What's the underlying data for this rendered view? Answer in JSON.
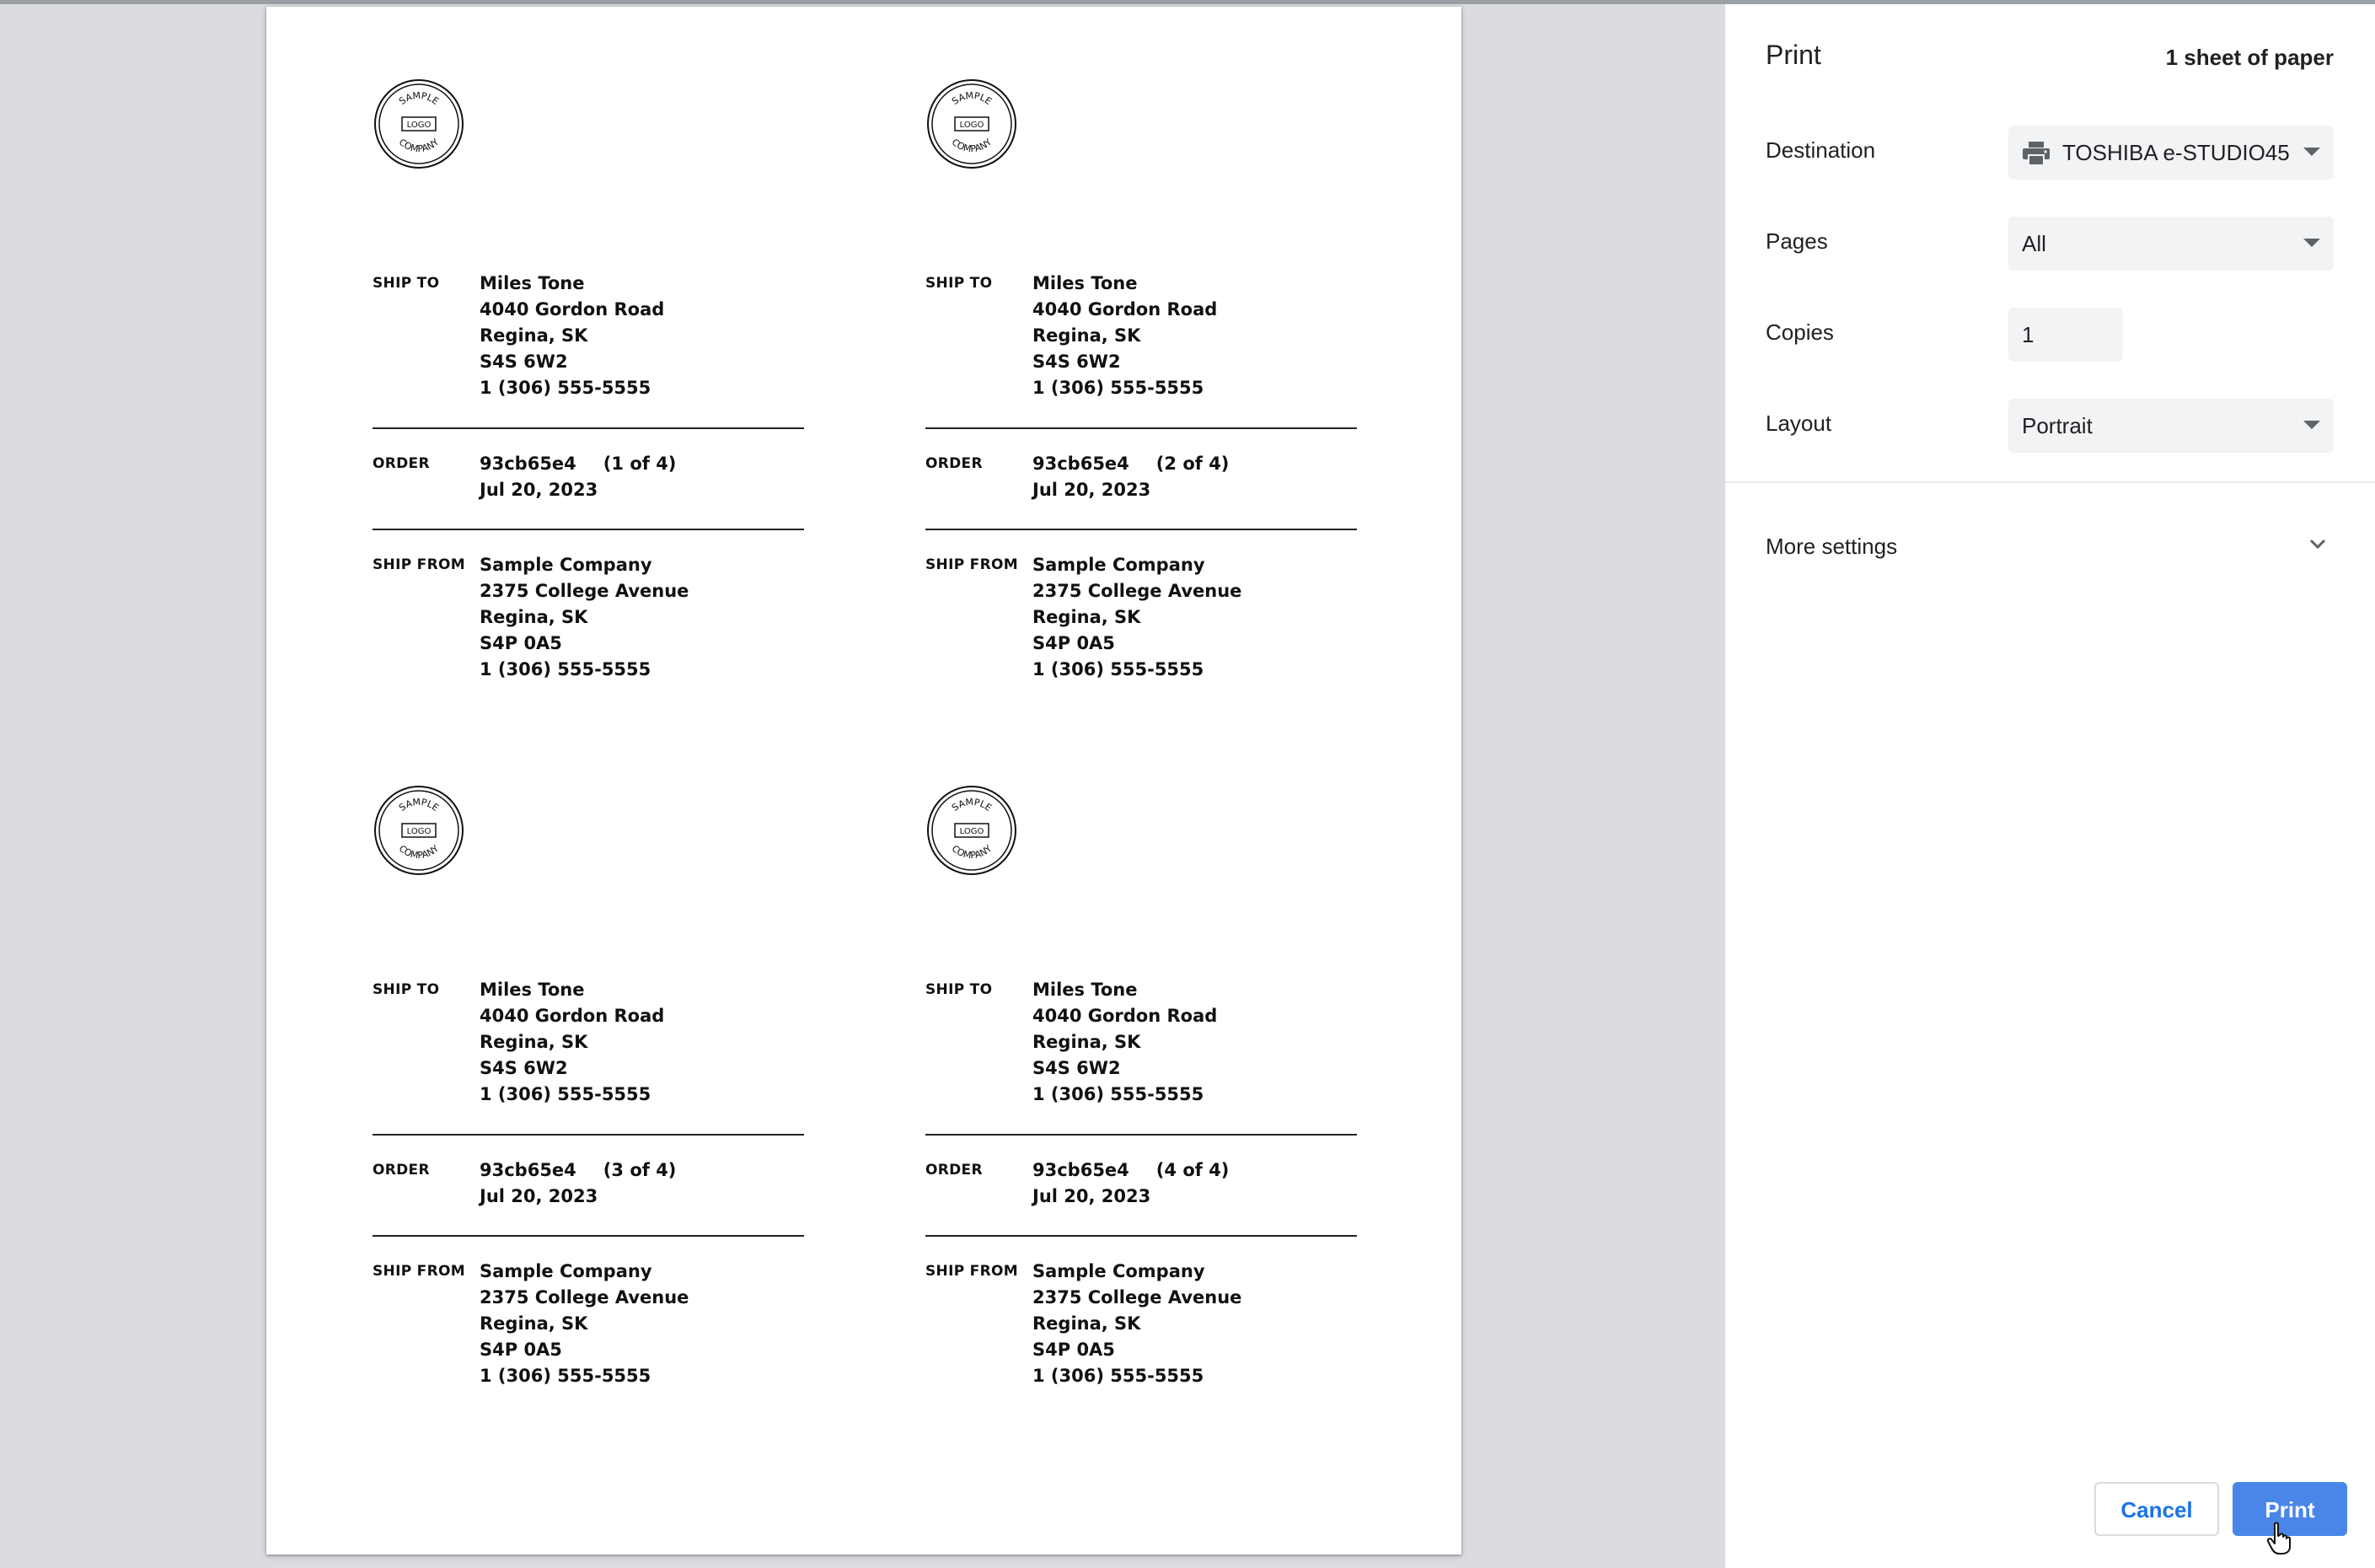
{
  "sidebar": {
    "title": "Print",
    "sheet_count": "1 sheet of paper",
    "destination": {
      "label": "Destination",
      "value": "TOSHIBA e-STUDIO45",
      "icon": "printer-icon"
    },
    "pages": {
      "label": "Pages",
      "value": "All"
    },
    "copies": {
      "label": "Copies",
      "value": "1"
    },
    "layout": {
      "label": "Layout",
      "value": "Portrait"
    },
    "more_settings": {
      "label": "More settings",
      "icon": "chevron-down-icon"
    },
    "cancel_label": "Cancel",
    "print_label": "Print",
    "accent_color": "#4a86e8"
  },
  "labels": [
    {
      "logo_text": {
        "top": "SAMPLE",
        "middle": "LOGO",
        "bottom": "COMPANY"
      },
      "ship_to": {
        "heading": "SHIP TO",
        "lines": [
          "Miles Tone",
          "4040 Gordon Road",
          "Regina, SK",
          "S4S 6W2",
          "1 (306) 555-5555"
        ]
      },
      "order": {
        "heading": "ORDER",
        "id": "93cb65e4",
        "index": "(1 of 4)",
        "date": "Jul 20, 2023"
      },
      "ship_from": {
        "heading": "SHIP FROM",
        "lines": [
          "Sample Company",
          "2375 College Avenue",
          "Regina, SK",
          "S4P 0A5",
          "1 (306) 555-5555"
        ]
      }
    },
    {
      "logo_text": {
        "top": "SAMPLE",
        "middle": "LOGO",
        "bottom": "COMPANY"
      },
      "ship_to": {
        "heading": "SHIP TO",
        "lines": [
          "Miles Tone",
          "4040 Gordon Road",
          "Regina, SK",
          "S4S 6W2",
          "1 (306) 555-5555"
        ]
      },
      "order": {
        "heading": "ORDER",
        "id": "93cb65e4",
        "index": "(2 of 4)",
        "date": "Jul 20, 2023"
      },
      "ship_from": {
        "heading": "SHIP FROM",
        "lines": [
          "Sample Company",
          "2375 College Avenue",
          "Regina, SK",
          "S4P 0A5",
          "1 (306) 555-5555"
        ]
      }
    },
    {
      "logo_text": {
        "top": "SAMPLE",
        "middle": "LOGO",
        "bottom": "COMPANY"
      },
      "ship_to": {
        "heading": "SHIP TO",
        "lines": [
          "Miles Tone",
          "4040 Gordon Road",
          "Regina, SK",
          "S4S 6W2",
          "1 (306) 555-5555"
        ]
      },
      "order": {
        "heading": "ORDER",
        "id": "93cb65e4",
        "index": "(3 of 4)",
        "date": "Jul 20, 2023"
      },
      "ship_from": {
        "heading": "SHIP FROM",
        "lines": [
          "Sample Company",
          "2375 College Avenue",
          "Regina, SK",
          "S4P 0A5",
          "1 (306) 555-5555"
        ]
      }
    },
    {
      "logo_text": {
        "top": "SAMPLE",
        "middle": "LOGO",
        "bottom": "COMPANY"
      },
      "ship_to": {
        "heading": "SHIP TO",
        "lines": [
          "Miles Tone",
          "4040 Gordon Road",
          "Regina, SK",
          "S4S 6W2",
          "1 (306) 555-5555"
        ]
      },
      "order": {
        "heading": "ORDER",
        "id": "93cb65e4",
        "index": "(4 of 4)",
        "date": "Jul 20, 2023"
      },
      "ship_from": {
        "heading": "SHIP FROM",
        "lines": [
          "Sample Company",
          "2375 College Avenue",
          "Regina, SK",
          "S4P 0A5",
          "1 (306) 555-5555"
        ]
      }
    }
  ]
}
